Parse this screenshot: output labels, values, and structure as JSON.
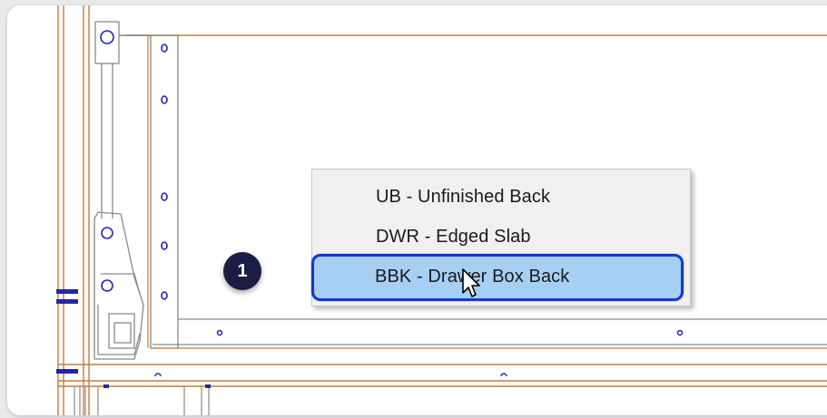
{
  "context_menu": {
    "items": [
      {
        "label": "UB - Unfinished Back",
        "selected": false
      },
      {
        "label": "DWR - Edged Slab",
        "selected": false
      },
      {
        "label": "BBK - Drawer Box Back",
        "selected": true
      }
    ]
  },
  "step_badge": {
    "number": "1"
  },
  "colors": {
    "frame_line": "#c97a3a",
    "selection_fill": "#a7cff4",
    "selection_border": "#1537d0",
    "badge": "#1b1d44",
    "hardware_blue": "#2426a8"
  },
  "icons": [
    "mouse-pointer-icon"
  ]
}
